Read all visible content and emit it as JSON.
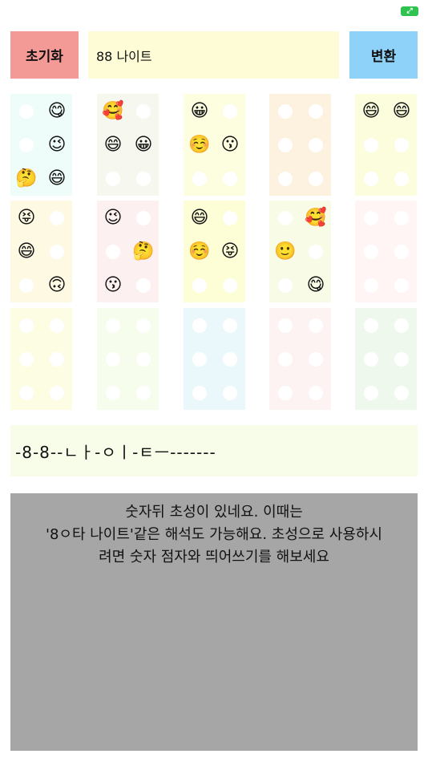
{
  "status": {
    "icon": "fullscreen-toggle-icon",
    "color": "#2ec24f"
  },
  "toolbar": {
    "reset_label": "초기화",
    "input_value": "88 나이트",
    "convert_label": "변환"
  },
  "colors": {
    "reset": "#f49a96",
    "input_bg": "#fdfcd6",
    "convert": "#8fd2f9",
    "result_bg": "#f7fde9",
    "explain_bg": "#a6a6a6"
  },
  "braille_cells": [
    {
      "bg": "#eefdf9",
      "dots": [
        "",
        "😋",
        "",
        "😉",
        "🤔",
        "😄"
      ]
    },
    {
      "bg": "#f6f8ef",
      "dots": [
        "🥰",
        "",
        "😄",
        "😀",
        "",
        ""
      ]
    },
    {
      "bg": "#fdfde0",
      "dots": [
        "😀",
        "",
        "☺️",
        "😗",
        "",
        ""
      ]
    },
    {
      "bg": "#fdf1df",
      "dots": [
        "",
        "",
        "",
        "",
        "",
        ""
      ]
    },
    {
      "bg": "#fbfddd",
      "dots": [
        "😄",
        "😄",
        "",
        "",
        "",
        ""
      ]
    },
    {
      "bg": "#fdf9e3",
      "dots": [
        "😝",
        "",
        "😄",
        "",
        "",
        "🙃"
      ]
    },
    {
      "bg": "#fdf0f1",
      "dots": [
        "😉",
        "",
        "",
        "🤔",
        "😗",
        ""
      ]
    },
    {
      "bg": "#fdfdd6",
      "dots": [
        "😄",
        "",
        "☺️",
        "😝",
        "",
        ""
      ]
    },
    {
      "bg": "#f8fbe6",
      "dots": [
        "",
        "🥰",
        "🙂",
        "",
        "",
        "😋"
      ]
    },
    {
      "bg": "#fef5f4",
      "dots": [
        "",
        "",
        "",
        "",
        "",
        ""
      ]
    },
    {
      "bg": "#fdfde3",
      "dots": [
        "",
        "",
        "",
        "",
        "",
        ""
      ]
    },
    {
      "bg": "#f7fdec",
      "dots": [
        "",
        "",
        "",
        "",
        "",
        ""
      ]
    },
    {
      "bg": "#eaf8fc",
      "dots": [
        "",
        "",
        "",
        "",
        "",
        ""
      ]
    },
    {
      "bg": "#fdf3f3",
      "dots": [
        "",
        "",
        "",
        "",
        "",
        ""
      ]
    },
    {
      "bg": "#eef8ec",
      "dots": [
        "",
        "",
        "",
        "",
        "",
        ""
      ]
    }
  ],
  "result": {
    "text": "-8-8--ㄴㅏ-ㅇㅣ-ㅌㅡ-------"
  },
  "explanation": {
    "line1": "숫자뒤 초성이 있네요. 이때는",
    "line2": "'8ㅇ타 나이트'같은 해석도 가능해요. 초성으로 사용하시",
    "line3": "려면 숫자 점자와 띄어쓰기를 해보세요"
  }
}
